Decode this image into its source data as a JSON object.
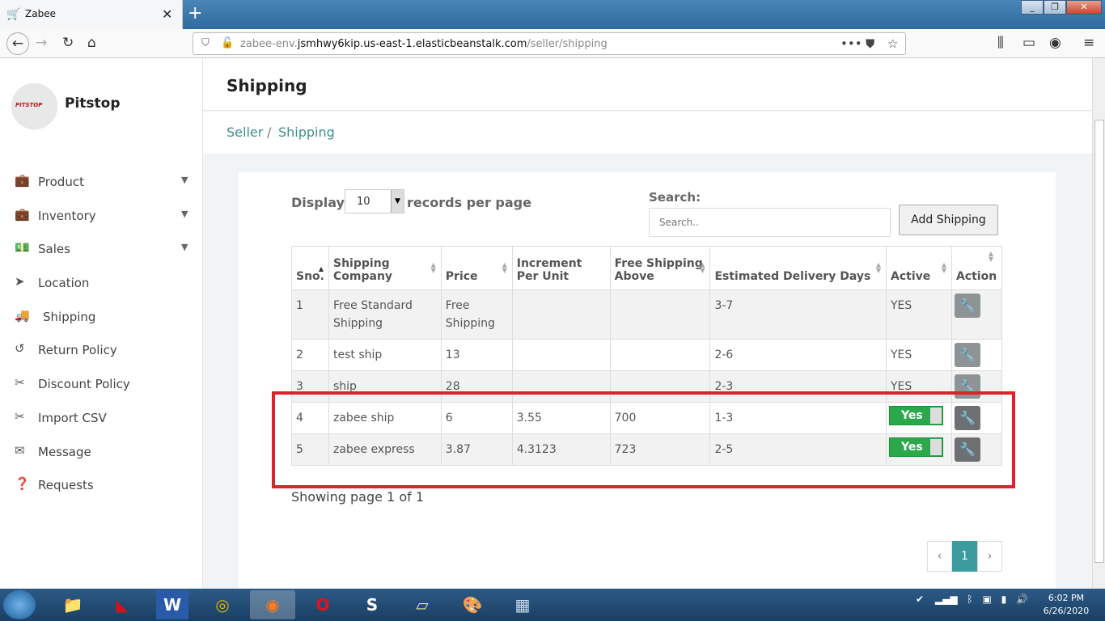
{
  "browser": {
    "tab_title": "Zabee",
    "url_prefix": "zabee-env.",
    "url_host": "jsmhwy6kip.us-east-1.elasticbeanstalk.com",
    "url_path": "/seller/shipping"
  },
  "sidebar": {
    "brand": "Pitstop",
    "logo_text": "PITSTOP",
    "items": [
      {
        "label": "Product",
        "icon": "briefcase-icon",
        "has_submenu": true
      },
      {
        "label": "Inventory",
        "icon": "briefcase-icon",
        "has_submenu": true
      },
      {
        "label": "Sales",
        "icon": "money-icon",
        "has_submenu": true
      },
      {
        "label": "Location",
        "icon": "location-arrow-icon",
        "has_submenu": false
      },
      {
        "label": "Shipping",
        "icon": "truck-icon",
        "has_submenu": false
      },
      {
        "label": "Return Policy",
        "icon": "undo-icon",
        "has_submenu": false
      },
      {
        "label": "Discount Policy",
        "icon": "scissors-icon",
        "has_submenu": false
      },
      {
        "label": "Import CSV",
        "icon": "scissors-icon",
        "has_submenu": false
      },
      {
        "label": "Message",
        "icon": "envelope-icon",
        "has_submenu": false
      },
      {
        "label": "Requests",
        "icon": "question-circle-icon",
        "has_submenu": false
      }
    ]
  },
  "page": {
    "title": "Shipping",
    "breadcrumb": [
      "Seller",
      "Shipping"
    ]
  },
  "controls": {
    "display_label": "Display",
    "page_size": "10",
    "records_label": "records per page",
    "search_label": "Search:",
    "search_placeholder": "Search..",
    "add_button": "Add Shipping"
  },
  "table": {
    "columns": [
      "Sno.",
      "Shipping Company",
      "Price",
      "Increment Per Unit",
      "Free Shipping Above",
      "Estimated Delivery Days",
      "Active",
      "Action"
    ],
    "rows": [
      {
        "sno": "1",
        "company": "Free Standard Shipping",
        "price": "Free Shipping",
        "increment": "",
        "free_above": "",
        "days": "3-7",
        "active": "YES",
        "toggle": false
      },
      {
        "sno": "2",
        "company": "test ship",
        "price": "13",
        "increment": "",
        "free_above": "",
        "days": "2-6",
        "active": "YES",
        "toggle": false
      },
      {
        "sno": "3",
        "company": "ship",
        "price": "28",
        "increment": "",
        "free_above": "",
        "days": "2-3",
        "active": "YES",
        "toggle": false
      },
      {
        "sno": "4",
        "company": "zabee ship",
        "price": "6",
        "increment": "3.55",
        "free_above": "700",
        "days": "1-3",
        "active": "Yes",
        "toggle": true
      },
      {
        "sno": "5",
        "company": "zabee express",
        "price": "3.87",
        "increment": "4.3123",
        "free_above": "723",
        "days": "2-5",
        "active": "Yes",
        "toggle": true
      }
    ]
  },
  "footer": {
    "showing": "Showing page 1 of 1",
    "current_page": "1"
  },
  "taskbar": {
    "time": "6:02 PM",
    "date": "6/26/2020"
  },
  "colors": {
    "accent": "#3b9b9e",
    "toggle_on": "#2aa84a",
    "highlight": "#e0202a"
  }
}
